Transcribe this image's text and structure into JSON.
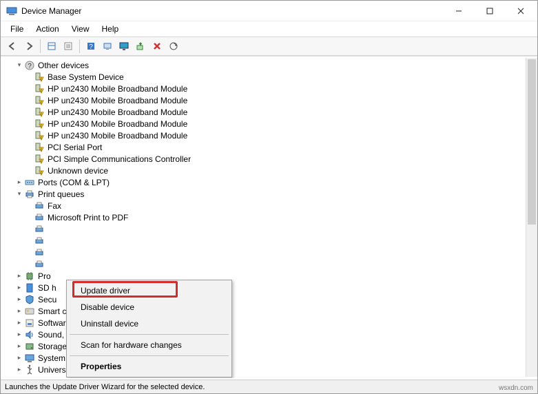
{
  "window": {
    "title": "Device Manager"
  },
  "menu": {
    "file": "File",
    "action": "Action",
    "view": "View",
    "help": "Help"
  },
  "toolbar_icons": {
    "back": "back-arrow",
    "forward": "forward-arrow",
    "show_hidden": "show-hidden",
    "properties": "properties",
    "help": "help",
    "computer": "computer",
    "monitor": "monitor",
    "enable": "enable",
    "delete": "delete",
    "scan": "scan"
  },
  "tree": {
    "other_devices": {
      "label": "Other devices",
      "children": [
        "Base System Device",
        "HP un2430 Mobile Broadband Module",
        "HP un2430 Mobile Broadband Module",
        "HP un2430 Mobile Broadband Module",
        "HP un2430 Mobile Broadband Module",
        "HP un2430 Mobile Broadband Module",
        "PCI Serial Port",
        "PCI Simple Communications Controller",
        "Unknown device"
      ]
    },
    "ports": {
      "label": "Ports (COM & LPT)"
    },
    "print_queues": {
      "label": "Print queues",
      "children": [
        "Fax",
        "Microsoft Print to PDF",
        "",
        "",
        "",
        ""
      ]
    },
    "processors": {
      "label": "Pro"
    },
    "sd_host": {
      "label": "SD h"
    },
    "security": {
      "label": "Secu"
    },
    "smart_card": {
      "label": "Smart card readers"
    },
    "software": {
      "label": "Software devices"
    },
    "sound": {
      "label": "Sound, video and game controllers"
    },
    "storage": {
      "label": "Storage controllers"
    },
    "system": {
      "label": "System devices"
    },
    "usb": {
      "label": "Universal Serial Bus controllers"
    }
  },
  "context_menu": {
    "update_driver": "Update driver",
    "disable_device": "Disable device",
    "uninstall_device": "Uninstall device",
    "scan_hardware": "Scan for hardware changes",
    "properties": "Properties"
  },
  "statusbar": {
    "text": "Launches the Update Driver Wizard for the selected device."
  },
  "watermark": "wsxdn.com"
}
